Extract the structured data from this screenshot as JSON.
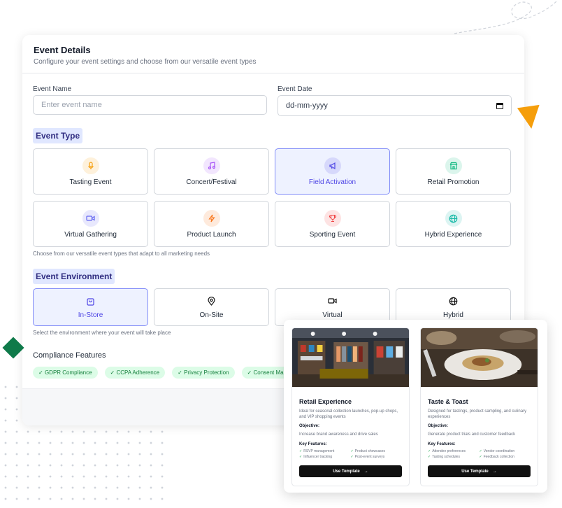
{
  "header": {
    "title": "Event Details",
    "subtitle": "Configure your event settings and choose from our versatile event types"
  },
  "fields": {
    "name_label": "Event Name",
    "name_placeholder": "Enter event name",
    "date_label": "Event Date",
    "date_placeholder": "dd-mm-yyyy"
  },
  "event_type": {
    "title": "Event Type",
    "hint": "Choose from our versatile event types that adapt to all marketing needs",
    "selected": "Field Activation",
    "items": [
      {
        "label": "Tasting Event",
        "icon": "microphone-icon",
        "color": "#f59e0b"
      },
      {
        "label": "Concert/Festival",
        "icon": "music-note-icon",
        "color": "#a855f7"
      },
      {
        "label": "Field Activation",
        "icon": "megaphone-icon",
        "color": "#4f46e5"
      },
      {
        "label": "Retail Promotion",
        "icon": "store-icon",
        "color": "#10b981"
      },
      {
        "label": "Virtual Gathering",
        "icon": "video-icon",
        "color": "#6366f1"
      },
      {
        "label": "Product Launch",
        "icon": "lightning-icon",
        "color": "#f97316"
      },
      {
        "label": "Sporting Event",
        "icon": "trophy-icon",
        "color": "#ef4444"
      },
      {
        "label": "Hybrid Experience",
        "icon": "globe-icon",
        "color": "#14b8a6"
      }
    ]
  },
  "environment": {
    "title": "Event Environment",
    "hint": "Select the environment where your event will take place",
    "selected": "In-Store",
    "items": [
      {
        "label": "In-Store",
        "icon": "shopping-bag-icon"
      },
      {
        "label": "On-Site",
        "icon": "location-pin-icon"
      },
      {
        "label": "Virtual",
        "icon": "video-icon"
      },
      {
        "label": "Hybrid",
        "icon": "globe-icon"
      }
    ]
  },
  "compliance": {
    "title": "Compliance Features",
    "chips": [
      "GDPR Compliance",
      "CCPA Adherence",
      "Privacy Protection",
      "Consent Ma"
    ]
  },
  "templates": [
    {
      "title": "Retail Experience",
      "description": "Ideal for seasonal collection launches, pop-up shops, and VIP shopping events",
      "objective_label": "Objective:",
      "objective": "Increase brand awareness and drive sales",
      "features_label": "Key Features:",
      "features": [
        "RSVP management",
        "Product showcases",
        "Influencer tracking",
        "Post-event surveys"
      ],
      "button": "Use Template",
      "image": "retail-store-photo"
    },
    {
      "title": "Taste & Toast",
      "description": "Designed for tastings, product sampling, and culinary experiences",
      "objective_label": "Objective:",
      "objective": "Generate product trials and customer feedback",
      "features_label": "Key Features:",
      "features": [
        "Attendee preferences",
        "Vendor coordination",
        "Tasting schedules",
        "Feedback collection"
      ],
      "button": "Use Template",
      "image": "plated-dish-photo"
    }
  ]
}
